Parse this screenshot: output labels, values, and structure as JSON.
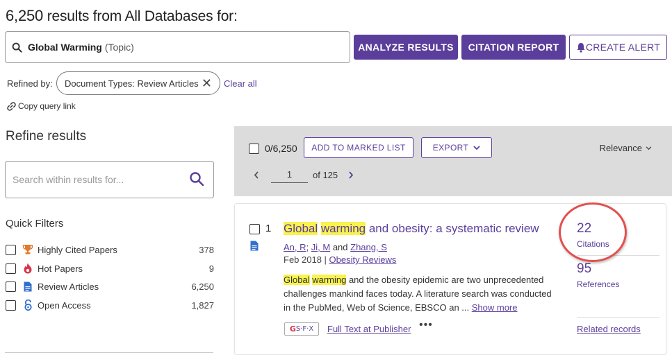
{
  "header": {
    "count": "6,250",
    "count_suffix": " results from All Databases for:"
  },
  "query": {
    "term": "Global Warming",
    "field": "(Topic)"
  },
  "actions": {
    "analyze": "ANALYZE RESULTS",
    "citation": "CITATION REPORT",
    "alert": "CREATE ALERT"
  },
  "refined": {
    "label": "Refined by:",
    "chip": "Document Types: Review Articles",
    "clear_all": "Clear all",
    "copy_link": "Copy query link"
  },
  "sidebar": {
    "title": "Refine results",
    "search_placeholder": "Search within results for...",
    "quick_filters_title": "Quick Filters",
    "filters": [
      {
        "label": "Highly Cited Papers",
        "count": "378",
        "icon": "trophy-icon"
      },
      {
        "label": "Hot Papers",
        "count": "9",
        "icon": "flame-icon"
      },
      {
        "label": "Review Articles",
        "count": "6,250",
        "icon": "document-icon"
      },
      {
        "label": "Open Access",
        "count": "1,827",
        "icon": "open-lock-icon"
      }
    ]
  },
  "toolbar": {
    "selected": "0/6,250",
    "add_marked": "ADD TO MARKED LIST",
    "export": "EXPORT",
    "sort": "Relevance",
    "page": "1",
    "of_pages": "of 125"
  },
  "record": {
    "index": "1",
    "title_hl1": "Global",
    "title_hl2": "warming",
    "title_rest": " and obesity: a systematic review",
    "author1": "An, R",
    "author2": "Ji, M",
    "author_and": " and ",
    "author3": "Zhang, S",
    "date": "Feb 2018 | ",
    "journal": "Obesity Reviews",
    "abs_hl1": "Global",
    "abs_hl2": "warming",
    "abstract": " and the obesity epidemic are two unprecedented challenges mankind faces today. A literature search was conducted in the PubMed, Web of Science, EBSCO an  ... ",
    "show_more": "Show more",
    "sfx_label": "S·F·X",
    "full_text": "Full Text at Publisher",
    "more": "•••",
    "citations_count": "22",
    "citations_label": "Citations",
    "references_count": "95",
    "references_label": "References",
    "related": "Related records"
  },
  "colors": {
    "accent": "#5b3e9b",
    "highlight": "#f9f24f",
    "annotation_circle": "#e2504e"
  }
}
